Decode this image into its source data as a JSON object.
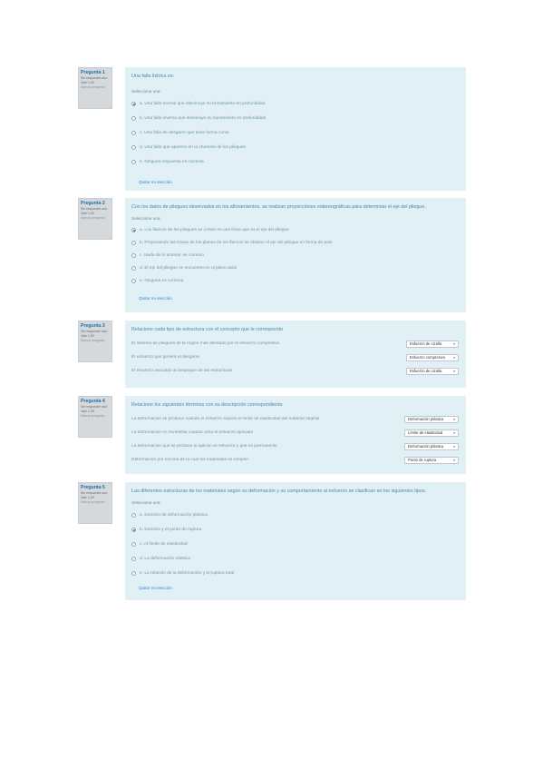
{
  "colors": {
    "panel": "#e0f0f5",
    "info": "#d6d9dc",
    "accent": "#1f6fa8",
    "text": "#6f97ab"
  },
  "q1": {
    "info": {
      "title": "Pregunta 1",
      "status": "Sin responder aún",
      "points": "Vale 1,00",
      "flag": "Marcar pregunta"
    },
    "text": "Una falla lístrica es:",
    "select_label": "Seleccione una:",
    "options": [
      "a. Una falla normal que disminuye su buzamiento en profundidad",
      "b. Una falla inversa que disminuye su buzamiento en profundidad",
      "c. Una falla de desgarre que tiene forma curva",
      "d. Una falla que aparece en la charnela de los pliegues",
      "e. Ninguna respuesta es correcta"
    ],
    "clear": "Quitar mi elección"
  },
  "q2": {
    "info": {
      "title": "Pregunta 2",
      "status": "Sin responder aún",
      "points": "Vale 1,00",
      "flag": "Marcar pregunta"
    },
    "text": "Con los datos de pliegues observados en los afloramientos, se realizan proyecciones estereográficas para determinar el eje del pliegue.",
    "select_label": "Seleccione una:",
    "options": [
      "a. Los flancos de los pliegues se cortan en una línea que es el eje del pliegue",
      "b. Proyectando las trazas de los planos de los flancos se obtiene el eje del pliegue en forma de polo",
      "c. Nada de lo anterior es correcto",
      "d. El eje del pliegue se encuentra en el plano axial",
      "e. Ninguna es correcta"
    ],
    "clear": "Quitar mi elección"
  },
  "q3": {
    "info": {
      "title": "Pregunta 3",
      "status": "Sin responder aún",
      "points": "Vale 1,00",
      "flag": "Marcar pregunta"
    },
    "text": "Relacione cada tipo de estructura con el concepto que le corresponde",
    "rows": [
      {
        "text": "El sistema de pliegues de la región más afectado por el esfuerzo compresivo",
        "choice": "Esfuerzo de cizalla"
      },
      {
        "text": "El esfuerzo que genera el desgarre",
        "choice": "Esfuerzo compresivo"
      },
      {
        "text": "El esfuerzo asociado al despegue de las estructuras",
        "choice": "Esfuerzo de cizalla"
      }
    ]
  },
  "q4": {
    "info": {
      "title": "Pregunta 4",
      "status": "Sin responder aún",
      "points": "Vale 1,00",
      "flag": "Marcar pregunta"
    },
    "text": "Relacione los siguientes términos con su descripción correspondiente",
    "rows": [
      {
        "text": "La deformación se produce cuando el esfuerzo supera el límite de elasticidad del material original",
        "choice": "Deformación plástica"
      },
      {
        "text": "La deformación es reversible cuando cesa el esfuerzo aplicado",
        "choice": "Límite de elasticidad"
      },
      {
        "text": "La deformación que se produce al aplicar un esfuerzo y que es permanente",
        "choice": "Deformación plástica"
      },
      {
        "text": "Deformación por encima de la cual los materiales se rompen",
        "choice": "Punto de ruptura"
      }
    ]
  },
  "q5": {
    "info": {
      "title": "Pregunta 5",
      "status": "Sin responder aún",
      "points": "Vale 1,00",
      "flag": "Marcar pregunta"
    },
    "text": "Las diferentes estructuras de los materiales según su deformación y su comportamiento al esfuerzo se clasifican en los siguientes tipos:",
    "select_label": "Seleccione una:",
    "options": [
      "a. Dominio de deformación plástica",
      "b. Dominio y el punto de ruptura",
      "c. Al límite de elasticidad",
      "d. La deformación elástica",
      "e. La relación de la deformación y la ruptura total"
    ],
    "clear": "Quitar mi elección"
  }
}
